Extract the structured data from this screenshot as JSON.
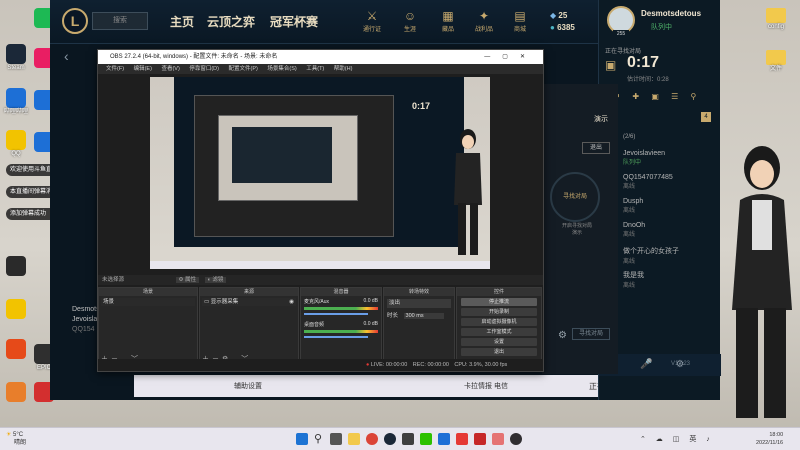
{
  "desktop": {
    "left_icons": [
      {
        "label": "Steam",
        "color": "#1b2838"
      },
      {
        "label": "QQ音乐",
        "color": "#1db954"
      },
      {
        "label": "哔哩哔哩",
        "color": "#e87e2b"
      },
      {
        "label": "英雄联盟",
        "color": "#c8aa6e"
      },
      {
        "label": "",
        "color": "#1d6fd6"
      },
      {
        "label": "",
        "color": "#2a2a2a"
      },
      {
        "label": "QQ",
        "color": "#f2c300"
      },
      {
        "label": "EPIC",
        "color": "#2f2f2f"
      },
      {
        "label": "",
        "color": "#e64a19"
      },
      {
        "label": "",
        "color": "#d32f2f"
      }
    ],
    "right_icons": [
      {
        "label": "config"
      },
      {
        "label": "文件"
      }
    ],
    "notifications": [
      "欢迎使用斗鱼直播助手",
      "本直播间弹幕消息和礼物消息",
      "添加弹幕成功"
    ]
  },
  "lol": {
    "search_placeholder": "搜索",
    "nav": [
      "主页",
      "云顶之弈",
      "冠军杯赛"
    ],
    "top_icons": [
      {
        "icon": "pass-icon",
        "glyph": "⚔",
        "label": "通行证"
      },
      {
        "icon": "profile-icon",
        "glyph": "☺",
        "label": "生涯"
      },
      {
        "icon": "collection-icon",
        "glyph": "▦",
        "label": "藏品"
      },
      {
        "icon": "tactics-icon",
        "glyph": "✦",
        "label": "战利品"
      },
      {
        "icon": "store-icon",
        "glyph": "▤",
        "label": "商城"
      }
    ],
    "currency": {
      "rp": "25",
      "be": "6385"
    },
    "username": "Desmotsdetous",
    "status": "队列中",
    "level": "255",
    "queue_label": "正在寻找对局",
    "queue_timer": "0:17",
    "queue_sub": "估计时间：0:28",
    "lobby_title": "演示",
    "group_count": "(2/6)",
    "leave_label": "退出",
    "friends": [
      {
        "name": "Jevoislavieen",
        "status": "队列中"
      },
      {
        "name": "QQ1547077485",
        "status": "离线"
      },
      {
        "name": "Dusph",
        "status": "离线"
      },
      {
        "name": "DnoOh",
        "status": "离线"
      },
      {
        "name": "做个开心的女孩子",
        "status": "离线"
      },
      {
        "name": "我是我",
        "status": "离线"
      }
    ],
    "find_match": "寻找对局",
    "find_match_hint": "开启寻找对局\n演示",
    "bottom_status": "正在运行…",
    "bottom_left": "Desmotsd",
    "bottom_left2": "Jevoislav",
    "bottom_left3": "QQ154",
    "version": "V13.23"
  },
  "obs": {
    "title": "OBS 27.2.4 (64-bit, windows) - 配置文件: 未命名 - 场景: 未命名",
    "menu": [
      "文件(F)",
      "编辑(E)",
      "查看(V)",
      "停靠窗口(D)",
      "配置文件(P)",
      "场景集合(S)",
      "工具(T)",
      "帮助(H)"
    ],
    "no_source": "未选择源",
    "props_btn": "属性",
    "filter_btn": "滤镜",
    "docks": {
      "scenes": "场景",
      "sources": "来源",
      "mixer": "混音器",
      "transitions": "转场特效",
      "controls": "控件"
    },
    "scene_item": "场景",
    "source_item": "显示器采集",
    "mixer": [
      {
        "name": "麦克风/Aux",
        "db": "0.0 dB"
      },
      {
        "name": "桌面音频",
        "db": "0.0 dB"
      }
    ],
    "transition_type": "淡出",
    "duration_label": "时长",
    "duration_value": "300 ms",
    "controls": [
      "停止推流",
      "开始录制",
      "启动虚拟摄像机",
      "工作室模式",
      "设置",
      "退出"
    ],
    "statusbar": "LIVE: 00:00:00   REC: 00:00:00   CPU: 3.9%, 30.00 fps",
    "live_time": "00:00:00",
    "rec_time": "00:00:00",
    "cpu": "CPU: 3.9%, 30.00 fps"
  },
  "bottom_bar": {
    "game_entry": "卡拉情报 电信",
    "assist": "辅助设置",
    "fps_text": "正在运行…"
  },
  "taskbar": {
    "weather": "5°C",
    "weather_desc": "晴朗",
    "time": "18:00",
    "date": "2022/11/16"
  }
}
